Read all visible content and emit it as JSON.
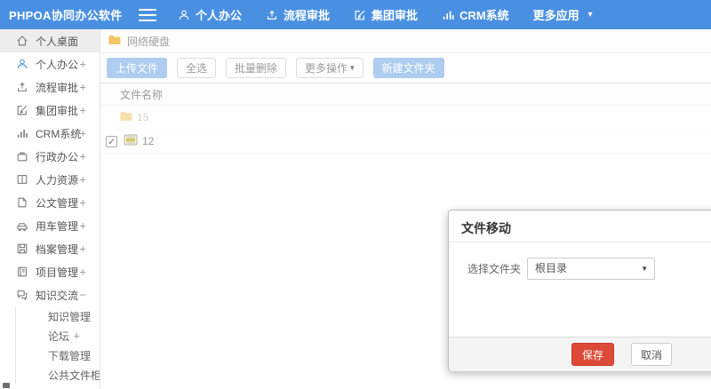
{
  "topbar": {
    "logo": "PHPOA协同办公软件",
    "nav": [
      {
        "label": "个人办公"
      },
      {
        "label": "流程审批"
      },
      {
        "label": "集团审批"
      },
      {
        "label": "CRM系统"
      },
      {
        "label": "更多应用"
      }
    ]
  },
  "sidebar": {
    "items": [
      {
        "label": "个人桌面",
        "expand": ""
      },
      {
        "label": "个人办公",
        "expand": "+"
      },
      {
        "label": "流程审批",
        "expand": "+"
      },
      {
        "label": "集团审批",
        "expand": "+"
      },
      {
        "label": "CRM系统",
        "expand": "+"
      },
      {
        "label": "行政办公",
        "expand": "+"
      },
      {
        "label": "人力资源",
        "expand": "+"
      },
      {
        "label": "公文管理",
        "expand": "+"
      },
      {
        "label": "用车管理",
        "expand": "+"
      },
      {
        "label": "档案管理",
        "expand": "+"
      },
      {
        "label": "项目管理",
        "expand": "+"
      },
      {
        "label": "知识交流",
        "expand": "−"
      }
    ],
    "subitems": [
      {
        "label": "知识管理",
        "expand": ""
      },
      {
        "label": "论坛",
        "expand": "+"
      },
      {
        "label": "下载管理",
        "expand": ""
      },
      {
        "label": "公共文件柜",
        "expand": ""
      }
    ]
  },
  "main": {
    "breadcrumb": "网络硬盘",
    "toolbar": {
      "upload": "上传文件",
      "select_all": "全选",
      "batch_delete": "批量删除",
      "more_ops": "更多操作",
      "new_folder": "新建文件夹"
    },
    "table": {
      "header": "文件名称",
      "rows": [
        {
          "name": "15",
          "type": "folder",
          "checked": false
        },
        {
          "name": "12",
          "type": "file",
          "checked": true
        }
      ]
    }
  },
  "modal": {
    "title": "文件移动",
    "label": "选择文件夹",
    "select_value": "根目录",
    "save": "保存",
    "cancel": "取消"
  },
  "colors": {
    "topbar_blue": "#4a90e2",
    "light_blue_button": "#aecdf0",
    "danger_red": "#dd4a38",
    "folder_yellow": "#f2c666"
  }
}
